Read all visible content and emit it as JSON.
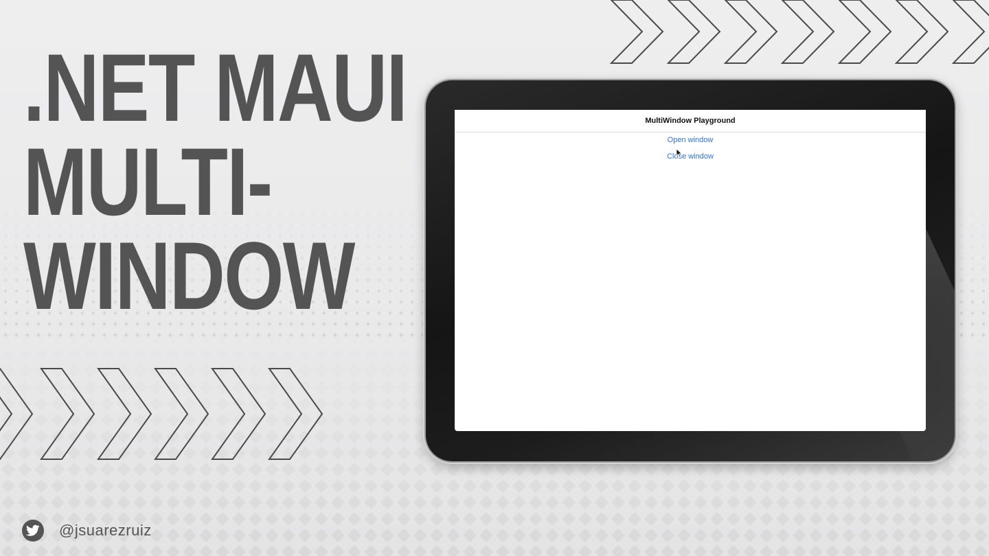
{
  "hero": {
    "line1": ".NET MAUI",
    "line2": "MULTI-",
    "line3": "WINDOW"
  },
  "app": {
    "window_title": "MultiWindow Playground",
    "open_label": "Open window",
    "close_label": "Close window"
  },
  "social": {
    "icon": "twitter-icon",
    "handle": "@jsuarezruiz"
  },
  "colors": {
    "heading": "#545454",
    "link": "#3572c9",
    "bezel": "#151515"
  }
}
